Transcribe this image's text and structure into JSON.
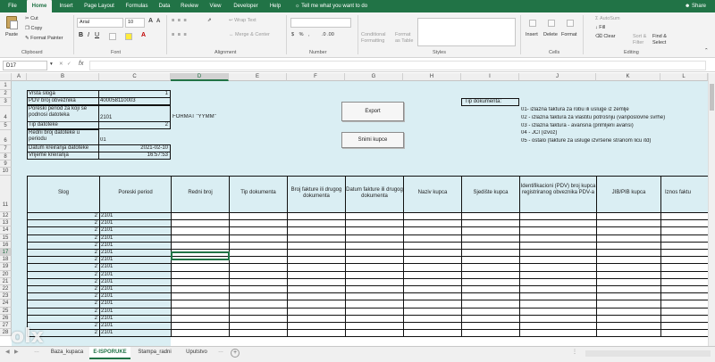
{
  "ribbon_tabs": [
    "File",
    "Home",
    "Insert",
    "Page Layout",
    "Formulas",
    "Data",
    "Review",
    "View",
    "Developer",
    "Help"
  ],
  "active_tab": "Home",
  "tell_me": "Tell me what you want to do",
  "share": "Share",
  "clipboard": {
    "paste": "Paste",
    "cut": "Cut",
    "copy": "Copy",
    "format_painter": "Format Painter",
    "label": "Clipboard"
  },
  "font": {
    "name": "Arial",
    "size": "10",
    "label": "Font"
  },
  "alignment": {
    "wrap": "Wrap Text",
    "merge": "Merge & Center",
    "label": "Alignment"
  },
  "number": {
    "label": "Number"
  },
  "styles": {
    "conditional": "Conditional Formatting",
    "format_table": "Format as Table",
    "label": "Styles"
  },
  "cells": {
    "insert": "Insert",
    "delete": "Delete",
    "format": "Format",
    "label": "Cells"
  },
  "editing": {
    "autosum": "AutoSum",
    "fill": "Fill",
    "clear": "Clear",
    "sort": "Sort & Filter",
    "find": "Find & Select",
    "label": "Editing"
  },
  "name_box": "D17",
  "fx": "fx",
  "columns": [
    "A",
    "B",
    "C",
    "D",
    "E",
    "F",
    "G",
    "H",
    "I",
    "J",
    "K",
    "L"
  ],
  "rows": [
    "1",
    "2",
    "3",
    "4",
    "5",
    "6",
    "7",
    "8",
    "9",
    "10",
    "11",
    "12",
    "13",
    "14",
    "15",
    "16",
    "17",
    "18",
    "19",
    "20",
    "21",
    "22",
    "23",
    "24",
    "25",
    "26",
    "27",
    "28"
  ],
  "info": {
    "vrsta_label": "Vrsta sloga",
    "vrsta_value": "1",
    "pdv_label": "PDV broj obveznika",
    "pdv_value": "400058110003",
    "period_label": "Poreski period za koji se podnosi datoteka",
    "period_value": "2101",
    "format_note": "FORMAT \"YYMM\"",
    "tip_label": "Tip datoteke",
    "tip_value": "2",
    "redni_label": "Redni broj datoteke u periodu",
    "redni_value": "01",
    "datum_label": "Datum kreiranja datoteke",
    "datum_value": "2021-02-10",
    "vrijeme_label": "Vrijeme kreiranja",
    "vrijeme_value": "16:57:53"
  },
  "buttons": {
    "export": "Export",
    "snimi": "Snimi kupce"
  },
  "tip_dokumenta": {
    "title": "Tip dokumenta:",
    "items": [
      "01- izlazna faktura za robu ili usluge iz zemlje",
      "02 - izlazna faktura za vlastitu potrošnju (vanposlovne svrhe)",
      "03 - izlazna faktura - avansna (primljeni avansi)",
      "04 - JCI (izvoz)",
      "05 - ostalo (fakture za usluge izvršene stranom licu itd)"
    ]
  },
  "table_headers": [
    "Slog",
    "Poreski period",
    "Redni broj",
    "Tip dokumenta",
    "Broj fakture ili drugog dokumenta",
    "Datum fakture ili drugog dokumenta",
    "Naziv kupca",
    "Sjedište kupca",
    "Identifikacioni (PDV) broj kupca registriranog obveznika PDV-a",
    "JIB/PIB kupca",
    "Iznos faktu"
  ],
  "data_rows": [
    {
      "slog": "2",
      "period": "2101"
    },
    {
      "slog": "2",
      "period": "2101"
    },
    {
      "slog": "2",
      "period": "2101"
    },
    {
      "slog": "2",
      "period": "2101"
    },
    {
      "slog": "2",
      "period": "2101"
    },
    {
      "slog": "2",
      "period": "2101"
    },
    {
      "slog": "2",
      "period": "2101"
    },
    {
      "slog": "2",
      "period": "2101"
    },
    {
      "slog": "2",
      "period": "2101"
    },
    {
      "slog": "2",
      "period": "2101"
    },
    {
      "slog": "2",
      "period": "2101"
    },
    {
      "slog": "2",
      "period": "2101"
    },
    {
      "slog": "2",
      "period": "2101"
    },
    {
      "slog": "2",
      "period": "2101"
    },
    {
      "slog": "2",
      "period": "2101"
    },
    {
      "slog": "2",
      "period": "2101"
    },
    {
      "slog": "2",
      "period": "2101"
    }
  ],
  "sheet_tabs": [
    "Baza_kupaca",
    "E-ISPORUKE",
    "Stampa_radni",
    "Uputstvo"
  ],
  "active_sheet": "E-ISPORUKE",
  "add_sheet": "+",
  "watermark": "olx"
}
